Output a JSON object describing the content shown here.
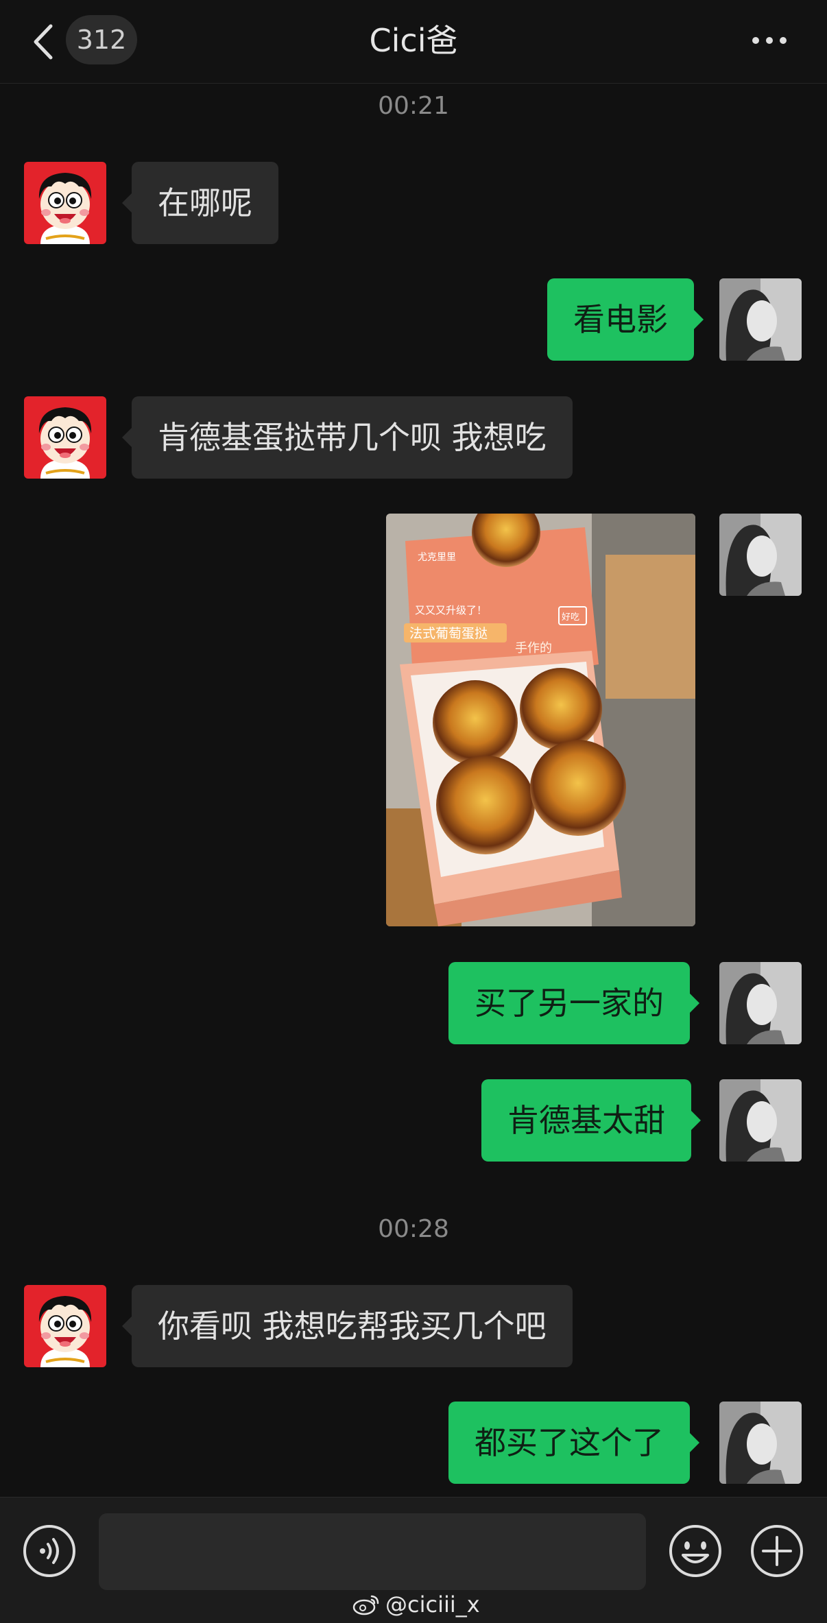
{
  "header": {
    "back_icon": "chevron-left-icon",
    "unread_count": "312",
    "title": "Cici爸",
    "more_icon": "ellipsis-icon"
  },
  "messages": {
    "time1": "00:21",
    "m1": "在哪呢",
    "m2": "看电影",
    "m3": "肯德基蛋挞带几个呗 我想吃",
    "photo": {
      "brand": "尤克里里",
      "headline": "又又又升级了！",
      "product": "法式葡萄蛋挞",
      "subline": "手作的",
      "badge": "好吃"
    },
    "m5": "买了另一家的",
    "m6": "肯德基太甜",
    "time2": "00:28",
    "m7": "你看呗 我想吃帮我买几个吧",
    "m8": "都买了这个了"
  },
  "footer": {
    "input_value": "",
    "voice_icon": "voice-icon",
    "emoji_icon": "emoji-icon",
    "plus_icon": "plus-icon",
    "watermark": "@ciciii_x"
  },
  "colors": {
    "background": "#111111",
    "bubble_left": "#2b2b2b",
    "bubble_right": "#1ec160"
  }
}
